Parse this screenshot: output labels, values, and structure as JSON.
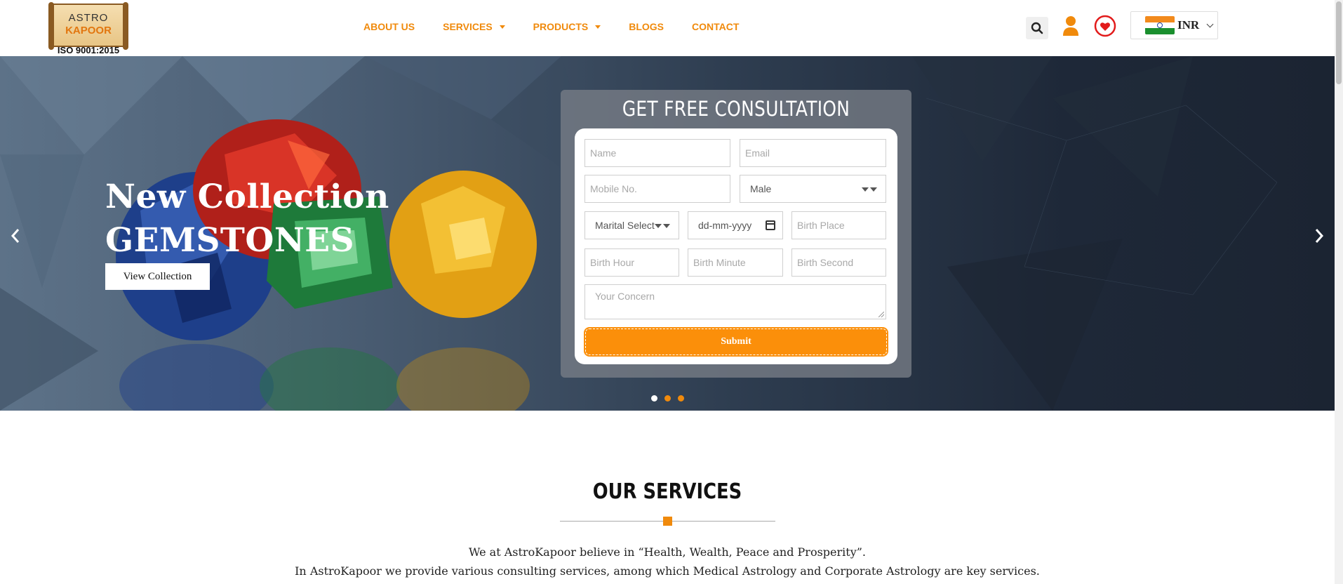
{
  "header": {
    "logo": {
      "line1": "ASTRO",
      "line2": "KAPOOR",
      "iso": "ISO 9001:2015"
    },
    "nav": [
      {
        "label": "ABOUT US",
        "dropdown": false
      },
      {
        "label": "SERVICES",
        "dropdown": true
      },
      {
        "label": "PRODUCTS",
        "dropdown": true
      },
      {
        "label": "BLOGS",
        "dropdown": false
      },
      {
        "label": "CONTACT",
        "dropdown": false
      }
    ],
    "icons": [
      "search-icon",
      "user-icon",
      "wishlist-heart-icon"
    ],
    "currency": {
      "code": "INR",
      "flag": "india-flag"
    },
    "accent_color": "#f08a0c"
  },
  "hero": {
    "title_line1": "New Collection",
    "title_line2": "GEMSTONES",
    "cta": "View Collection",
    "slides": {
      "count": 3,
      "active": 1
    }
  },
  "consultation": {
    "title": "GET FREE CONSULTATION",
    "fields": {
      "name": "Name",
      "email": "Email",
      "mobile": "Mobile No.",
      "gender": "Male",
      "marital": "Marital Select",
      "dob": "dd-mm-yyyy",
      "birth_place": "Birth Place",
      "birth_hour": "Birth Hour",
      "birth_minute": "Birth Minute",
      "birth_second": "Birth Second",
      "concern": "Your Concern"
    },
    "submit": "Submit",
    "submit_color": "#fb8f0a"
  },
  "services": {
    "title": "OUR SERVICES",
    "line1": "We at AstroKapoor believe in “Health, Wealth, Peace and Prosperity”.",
    "line2": "In AstroKapoor we provide various consulting services, among which Medical Astrology and Corporate Astrology are key services."
  }
}
